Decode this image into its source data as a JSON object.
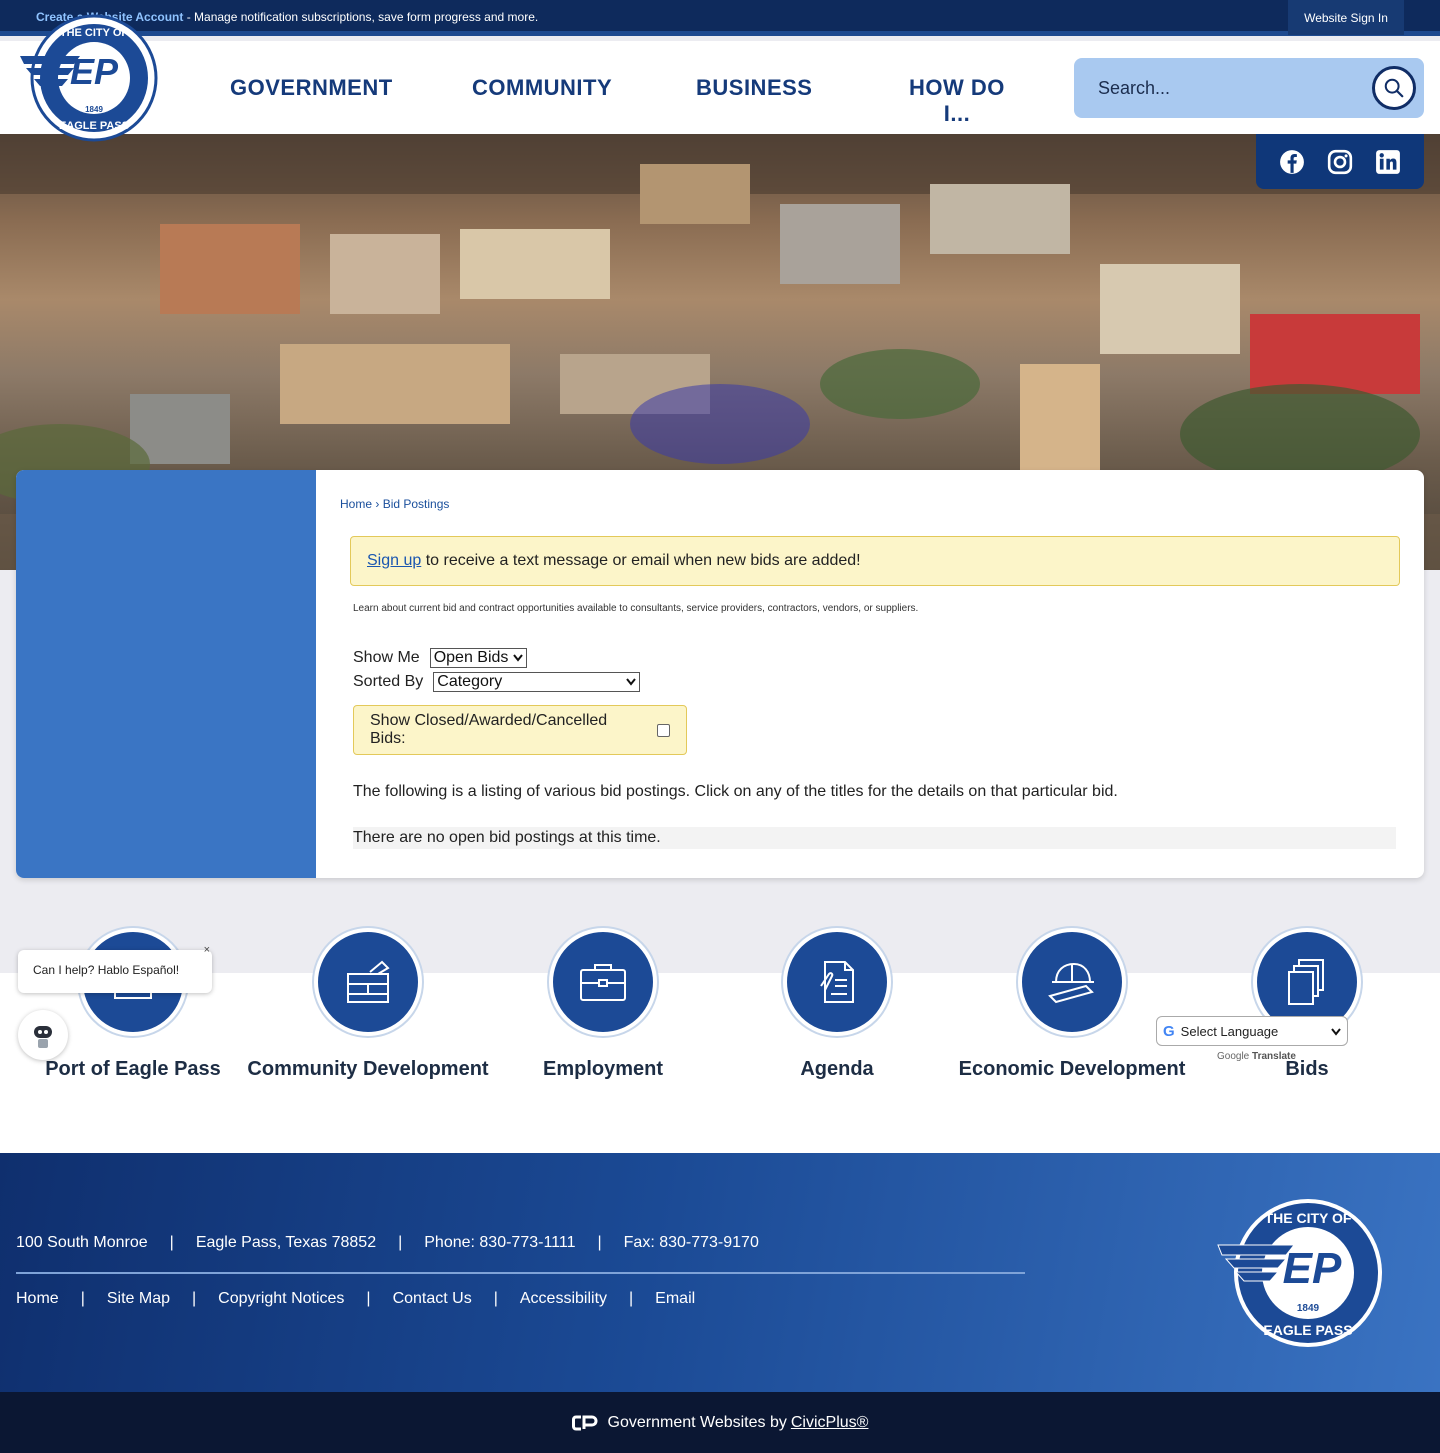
{
  "topbar": {
    "create_link": "Create a Website Account",
    "message": " - Manage notification subscriptions, save form progress and more.",
    "signin_label": "Website Sign In"
  },
  "logo": {
    "top_text": "THE CITY OF",
    "monogram": "EP",
    "year": "1849",
    "bottom_text": "EAGLE PASS"
  },
  "nav": {
    "items": [
      "GOVERNMENT",
      "COMMUNITY",
      "BUSINESS",
      "HOW DO I..."
    ]
  },
  "search": {
    "placeholder": "Search..."
  },
  "social": [
    "facebook-icon",
    "instagram-icon",
    "linkedin-icon"
  ],
  "breadcrumb": {
    "home": "Home",
    "sep": "›",
    "current": "Bid Postings"
  },
  "notice": {
    "link": "Sign up",
    "text": " to receive a text message or email when new bids are added!"
  },
  "intro": "Learn about current bid and contract opportunities available to consultants, service providers, contractors, vendors, or suppliers.",
  "filters": {
    "show_me_label": "Show Me",
    "show_me_value": "Open Bids",
    "sorted_by_label": "Sorted By",
    "sorted_by_value": "Category",
    "closed_label": "Show Closed/Awarded/Cancelled Bids:",
    "closed_checked": false
  },
  "listing_text": "The following is a listing of various bid postings. Click on any of the titles for the details on that particular bid.",
  "no_bids_text": "There are no open bid postings at this time.",
  "quick_links": [
    {
      "label": "Port of Eagle Pass",
      "icon": "port-icon"
    },
    {
      "label": "Community Development",
      "icon": "construction-icon"
    },
    {
      "label": "Employment",
      "icon": "briefcase-icon"
    },
    {
      "label": "Agenda",
      "icon": "document-icon"
    },
    {
      "label": "Economic Development",
      "icon": "hardhat-icon"
    },
    {
      "label": "Bids",
      "icon": "files-icon"
    }
  ],
  "chat": {
    "text": "Can I help? Hablo Español!",
    "close": "×"
  },
  "translate": {
    "label": "Select Language",
    "powered_by": "Google",
    "translate": "Translate"
  },
  "footer": {
    "address": "100 South Monroe",
    "city": "Eagle Pass, Texas 78852",
    "phone": "Phone: 830-773-1111",
    "fax": "Fax: 830-773-9170",
    "links": [
      "Home",
      "Site Map",
      "Copyright Notices",
      "Contact Us",
      "Accessibility",
      "Email"
    ],
    "separator": "|"
  },
  "bottom": {
    "text": "Government Websites by",
    "link": "CivicPlus®"
  },
  "colors": {
    "primary": "#153a7a",
    "accent": "#3a75c4",
    "notice_bg": "#fcf5c9"
  }
}
